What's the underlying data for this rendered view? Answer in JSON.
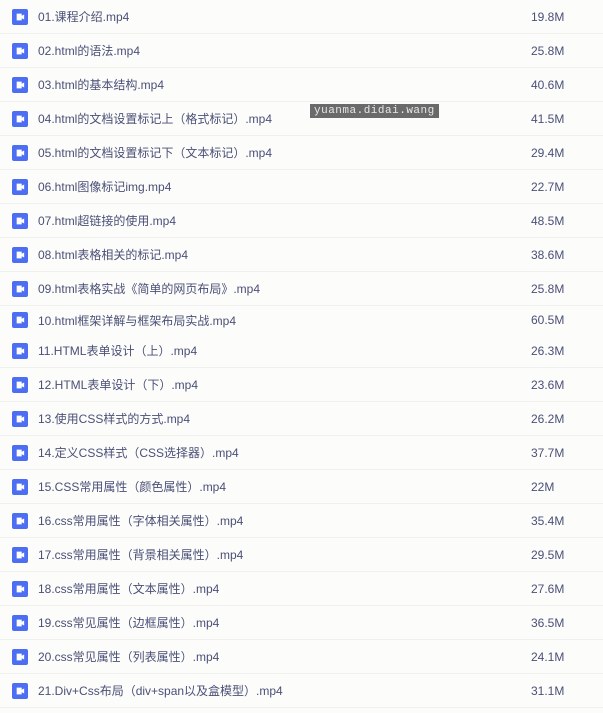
{
  "watermark": "yuanma.didai.wang",
  "files": [
    {
      "name": "01.课程介绍.mp4",
      "size": "19.8M",
      "alt": false
    },
    {
      "name": "02.html的语法.mp4",
      "size": "25.8M",
      "alt": false
    },
    {
      "name": "03.html的基本结构.mp4",
      "size": "40.6M",
      "alt": false
    },
    {
      "name": "04.html的文档设置标记上（格式标记）.mp4",
      "size": "41.5M",
      "alt": false
    },
    {
      "name": "05.html的文档设置标记下（文本标记）.mp4",
      "size": "29.4M",
      "alt": false
    },
    {
      "name": "06.html图像标记img.mp4",
      "size": "22.7M",
      "alt": false
    },
    {
      "name": "07.html超链接的使用.mp4",
      "size": "48.5M",
      "alt": false
    },
    {
      "name": "08.html表格相关的标记.mp4",
      "size": "38.6M",
      "alt": false
    },
    {
      "name": "09.html表格实战《简单的网页布局》.mp4",
      "size": "25.8M",
      "alt": false
    },
    {
      "name": "10.html框架详解与框架布局实战.mp4",
      "size": "60.5M",
      "alt": true
    },
    {
      "name": "11.HTML表单设计（上）.mp4",
      "size": "26.3M",
      "alt": false
    },
    {
      "name": "12.HTML表单设计（下）.mp4",
      "size": "23.6M",
      "alt": false
    },
    {
      "name": "13.使用CSS样式的方式.mp4",
      "size": "26.2M",
      "alt": false
    },
    {
      "name": "14.定义CSS样式（CSS选择器）.mp4",
      "size": "37.7M",
      "alt": false
    },
    {
      "name": "15.CSS常用属性（颜色属性）.mp4",
      "size": "22M",
      "alt": false
    },
    {
      "name": "16.css常用属性（字体相关属性）.mp4",
      "size": "35.4M",
      "alt": false
    },
    {
      "name": "17.css常用属性（背景相关属性）.mp4",
      "size": "29.5M",
      "alt": false
    },
    {
      "name": "18.css常用属性（文本属性）.mp4",
      "size": "27.6M",
      "alt": false
    },
    {
      "name": "19.css常见属性（边框属性）.mp4",
      "size": "36.5M",
      "alt": false
    },
    {
      "name": "20.css常见属性（列表属性）.mp4",
      "size": "24.1M",
      "alt": false
    },
    {
      "name": "21.Div+Css布局（div+span以及盒模型）.mp4",
      "size": "31.1M",
      "alt": false
    }
  ]
}
